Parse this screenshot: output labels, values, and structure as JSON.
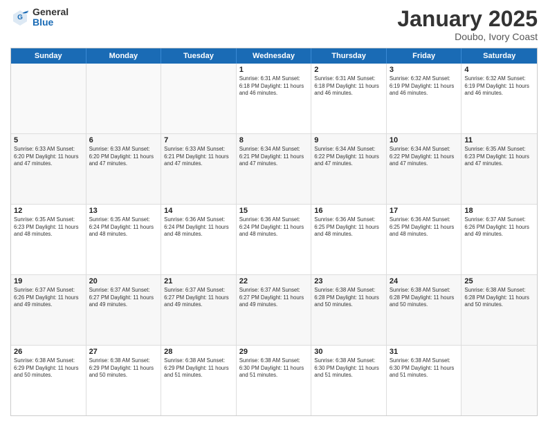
{
  "logo": {
    "general": "General",
    "blue": "Blue"
  },
  "header": {
    "month": "January 2025",
    "location": "Doubo, Ivory Coast"
  },
  "weekdays": [
    "Sunday",
    "Monday",
    "Tuesday",
    "Wednesday",
    "Thursday",
    "Friday",
    "Saturday"
  ],
  "rows": [
    [
      {
        "day": "",
        "info": ""
      },
      {
        "day": "",
        "info": ""
      },
      {
        "day": "",
        "info": ""
      },
      {
        "day": "1",
        "info": "Sunrise: 6:31 AM\nSunset: 6:18 PM\nDaylight: 11 hours\nand 46 minutes."
      },
      {
        "day": "2",
        "info": "Sunrise: 6:31 AM\nSunset: 6:18 PM\nDaylight: 11 hours\nand 46 minutes."
      },
      {
        "day": "3",
        "info": "Sunrise: 6:32 AM\nSunset: 6:19 PM\nDaylight: 11 hours\nand 46 minutes."
      },
      {
        "day": "4",
        "info": "Sunrise: 6:32 AM\nSunset: 6:19 PM\nDaylight: 11 hours\nand 46 minutes."
      }
    ],
    [
      {
        "day": "5",
        "info": "Sunrise: 6:33 AM\nSunset: 6:20 PM\nDaylight: 11 hours\nand 47 minutes."
      },
      {
        "day": "6",
        "info": "Sunrise: 6:33 AM\nSunset: 6:20 PM\nDaylight: 11 hours\nand 47 minutes."
      },
      {
        "day": "7",
        "info": "Sunrise: 6:33 AM\nSunset: 6:21 PM\nDaylight: 11 hours\nand 47 minutes."
      },
      {
        "day": "8",
        "info": "Sunrise: 6:34 AM\nSunset: 6:21 PM\nDaylight: 11 hours\nand 47 minutes."
      },
      {
        "day": "9",
        "info": "Sunrise: 6:34 AM\nSunset: 6:22 PM\nDaylight: 11 hours\nand 47 minutes."
      },
      {
        "day": "10",
        "info": "Sunrise: 6:34 AM\nSunset: 6:22 PM\nDaylight: 11 hours\nand 47 minutes."
      },
      {
        "day": "11",
        "info": "Sunrise: 6:35 AM\nSunset: 6:23 PM\nDaylight: 11 hours\nand 47 minutes."
      }
    ],
    [
      {
        "day": "12",
        "info": "Sunrise: 6:35 AM\nSunset: 6:23 PM\nDaylight: 11 hours\nand 48 minutes."
      },
      {
        "day": "13",
        "info": "Sunrise: 6:35 AM\nSunset: 6:24 PM\nDaylight: 11 hours\nand 48 minutes."
      },
      {
        "day": "14",
        "info": "Sunrise: 6:36 AM\nSunset: 6:24 PM\nDaylight: 11 hours\nand 48 minutes."
      },
      {
        "day": "15",
        "info": "Sunrise: 6:36 AM\nSunset: 6:24 PM\nDaylight: 11 hours\nand 48 minutes."
      },
      {
        "day": "16",
        "info": "Sunrise: 6:36 AM\nSunset: 6:25 PM\nDaylight: 11 hours\nand 48 minutes."
      },
      {
        "day": "17",
        "info": "Sunrise: 6:36 AM\nSunset: 6:25 PM\nDaylight: 11 hours\nand 48 minutes."
      },
      {
        "day": "18",
        "info": "Sunrise: 6:37 AM\nSunset: 6:26 PM\nDaylight: 11 hours\nand 49 minutes."
      }
    ],
    [
      {
        "day": "19",
        "info": "Sunrise: 6:37 AM\nSunset: 6:26 PM\nDaylight: 11 hours\nand 49 minutes."
      },
      {
        "day": "20",
        "info": "Sunrise: 6:37 AM\nSunset: 6:27 PM\nDaylight: 11 hours\nand 49 minutes."
      },
      {
        "day": "21",
        "info": "Sunrise: 6:37 AM\nSunset: 6:27 PM\nDaylight: 11 hours\nand 49 minutes."
      },
      {
        "day": "22",
        "info": "Sunrise: 6:37 AM\nSunset: 6:27 PM\nDaylight: 11 hours\nand 49 minutes."
      },
      {
        "day": "23",
        "info": "Sunrise: 6:38 AM\nSunset: 6:28 PM\nDaylight: 11 hours\nand 50 minutes."
      },
      {
        "day": "24",
        "info": "Sunrise: 6:38 AM\nSunset: 6:28 PM\nDaylight: 11 hours\nand 50 minutes."
      },
      {
        "day": "25",
        "info": "Sunrise: 6:38 AM\nSunset: 6:28 PM\nDaylight: 11 hours\nand 50 minutes."
      }
    ],
    [
      {
        "day": "26",
        "info": "Sunrise: 6:38 AM\nSunset: 6:29 PM\nDaylight: 11 hours\nand 50 minutes."
      },
      {
        "day": "27",
        "info": "Sunrise: 6:38 AM\nSunset: 6:29 PM\nDaylight: 11 hours\nand 50 minutes."
      },
      {
        "day": "28",
        "info": "Sunrise: 6:38 AM\nSunset: 6:29 PM\nDaylight: 11 hours\nand 51 minutes."
      },
      {
        "day": "29",
        "info": "Sunrise: 6:38 AM\nSunset: 6:30 PM\nDaylight: 11 hours\nand 51 minutes."
      },
      {
        "day": "30",
        "info": "Sunrise: 6:38 AM\nSunset: 6:30 PM\nDaylight: 11 hours\nand 51 minutes."
      },
      {
        "day": "31",
        "info": "Sunrise: 6:38 AM\nSunset: 6:30 PM\nDaylight: 11 hours\nand 51 minutes."
      },
      {
        "day": "",
        "info": ""
      }
    ]
  ]
}
